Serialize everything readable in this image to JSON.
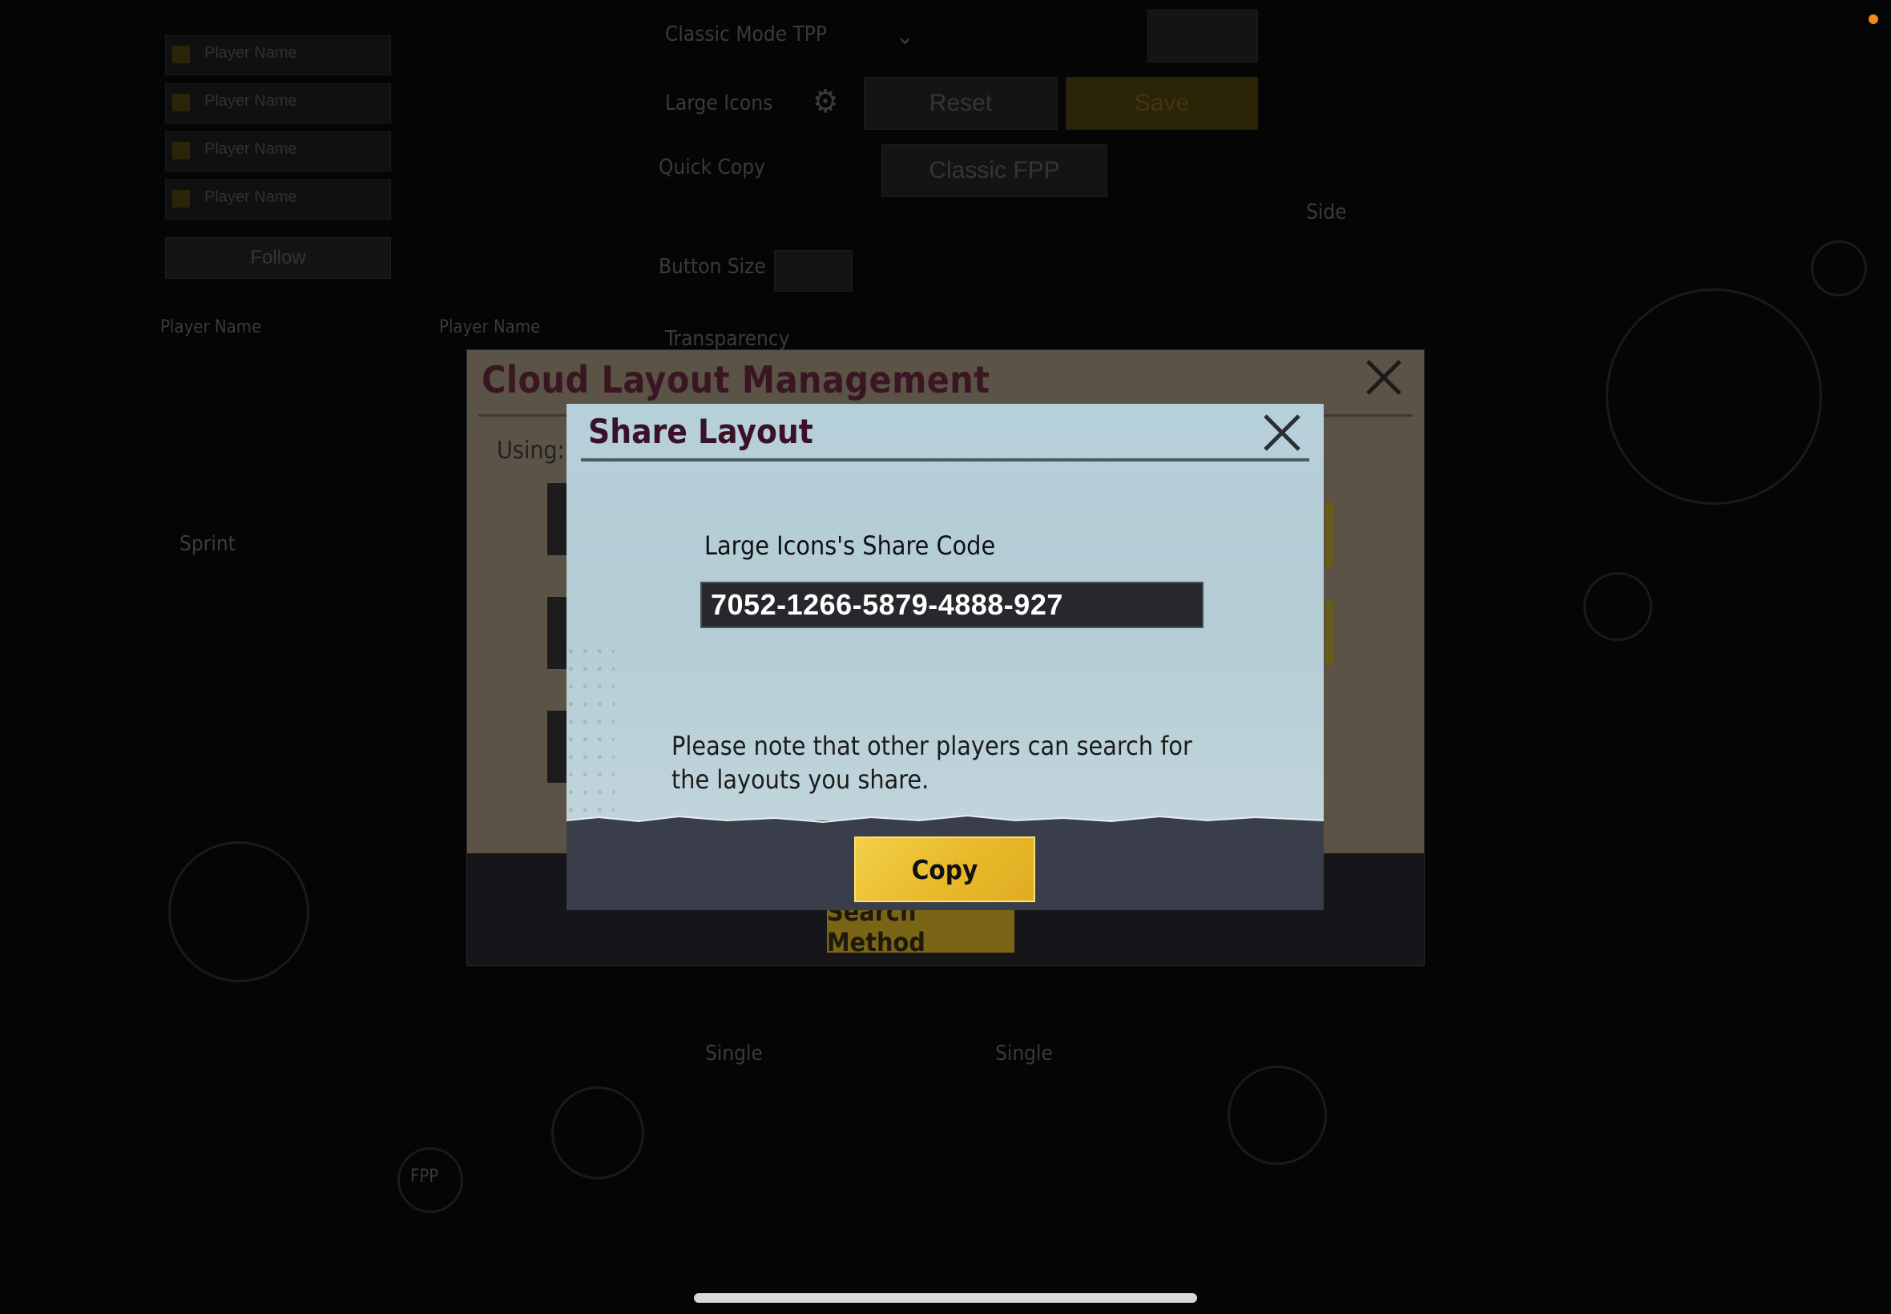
{
  "background": {
    "players": [
      "Player Name",
      "Player Name",
      "Player Name",
      "Player Name"
    ],
    "follow_label": "Follow",
    "player_left": "Player Name",
    "player_right": "Player Name",
    "mode_select": "Classic Mode TPP",
    "layout_name": "Large Icons",
    "reset_label": "Reset",
    "save_label": "Save",
    "quick_copy_label": "Quick Copy",
    "quick_copy_value": "Classic FPP",
    "button_size_label": "Button Size",
    "transparency_label": "Transparency",
    "sprint_label": "Sprint",
    "side_label": "Side",
    "fire_mode_left": "Single",
    "fire_mode_right": "Single",
    "fpp_label": "FPP"
  },
  "cloud_dialog": {
    "title": "Cloud Layout Management",
    "using_label": "Using: L",
    "search_method_label": "Search Method"
  },
  "share_dialog": {
    "title": "Share Layout",
    "code_label": "Large Icons's Share Code",
    "share_code": "7052-1266-5879-4888-927",
    "note": "Please note that other players can search for the layouts you share.",
    "copy_label": "Copy"
  },
  "colors": {
    "accent_yellow": "#EDBE2E",
    "title_maroon": "#3B1128",
    "code_box_bg": "#26282C",
    "status_dot": "#F08A1C"
  }
}
